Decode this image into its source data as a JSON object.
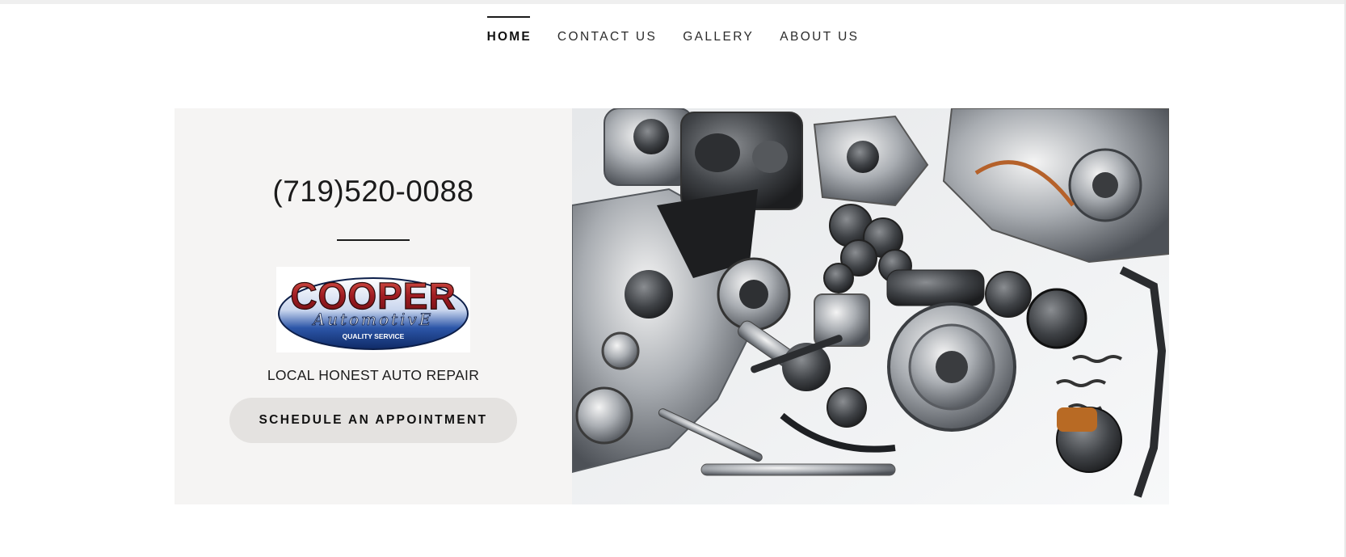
{
  "nav": {
    "items": [
      {
        "label": "HOME",
        "active": true
      },
      {
        "label": "CONTACT US",
        "active": false
      },
      {
        "label": "GALLERY",
        "active": false
      },
      {
        "label": "ABOUT US",
        "active": false
      }
    ]
  },
  "hero": {
    "phone": "(719)520-0088",
    "logo": {
      "brand": "COOPER",
      "script": "AutomotivE",
      "tagline": "QUALITY SERVICE"
    },
    "subtitle": "LOCAL HONEST AUTO REPAIR",
    "cta_label": "SCHEDULE AN APPOINTMENT",
    "image_icon": "engine-parts-photo"
  },
  "colors": {
    "panel_bg": "#f5f4f3",
    "button_bg": "#e4e2e0",
    "text": "#1b1b1b",
    "logo_red": "#b3262b",
    "logo_blue": "#1e3f8a"
  }
}
